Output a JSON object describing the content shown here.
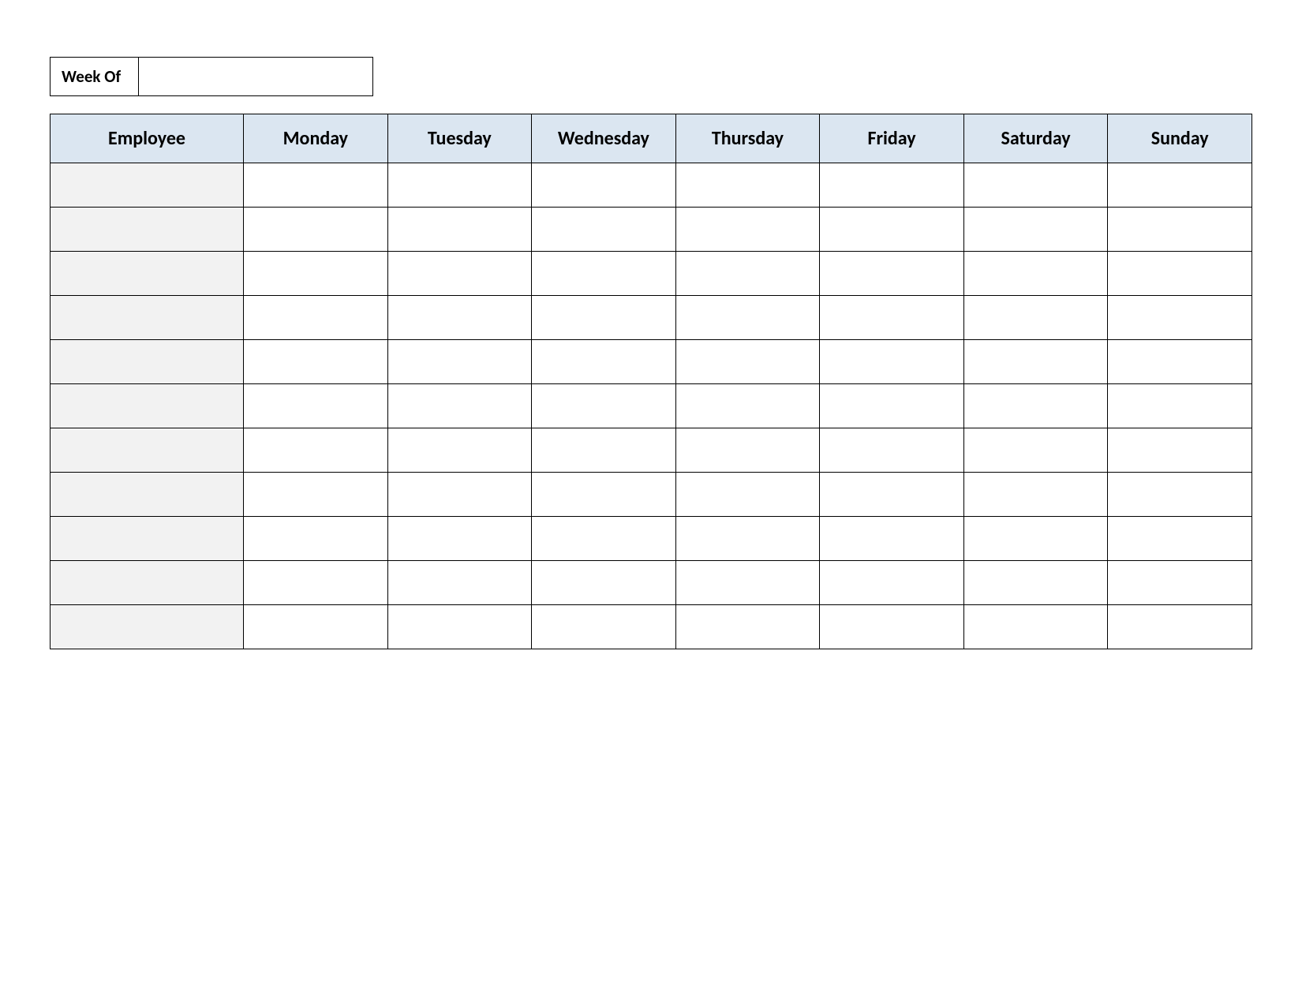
{
  "weekOf": {
    "label": "Week Of",
    "value": ""
  },
  "headers": {
    "employee": "Employee",
    "days": [
      "Monday",
      "Tuesday",
      "Wednesday",
      "Thursday",
      "Friday",
      "Saturday",
      "Sunday"
    ]
  },
  "rows": [
    {
      "employee": "",
      "mon": "",
      "tue": "",
      "wed": "",
      "thu": "",
      "fri": "",
      "sat": "",
      "sun": ""
    },
    {
      "employee": "",
      "mon": "",
      "tue": "",
      "wed": "",
      "thu": "",
      "fri": "",
      "sat": "",
      "sun": ""
    },
    {
      "employee": "",
      "mon": "",
      "tue": "",
      "wed": "",
      "thu": "",
      "fri": "",
      "sat": "",
      "sun": ""
    },
    {
      "employee": "",
      "mon": "",
      "tue": "",
      "wed": "",
      "thu": "",
      "fri": "",
      "sat": "",
      "sun": ""
    },
    {
      "employee": "",
      "mon": "",
      "tue": "",
      "wed": "",
      "thu": "",
      "fri": "",
      "sat": "",
      "sun": ""
    },
    {
      "employee": "",
      "mon": "",
      "tue": "",
      "wed": "",
      "thu": "",
      "fri": "",
      "sat": "",
      "sun": ""
    },
    {
      "employee": "",
      "mon": "",
      "tue": "",
      "wed": "",
      "thu": "",
      "fri": "",
      "sat": "",
      "sun": ""
    },
    {
      "employee": "",
      "mon": "",
      "tue": "",
      "wed": "",
      "thu": "",
      "fri": "",
      "sat": "",
      "sun": ""
    },
    {
      "employee": "",
      "mon": "",
      "tue": "",
      "wed": "",
      "thu": "",
      "fri": "",
      "sat": "",
      "sun": ""
    },
    {
      "employee": "",
      "mon": "",
      "tue": "",
      "wed": "",
      "thu": "",
      "fri": "",
      "sat": "",
      "sun": ""
    },
    {
      "employee": "",
      "mon": "",
      "tue": "",
      "wed": "",
      "thu": "",
      "fri": "",
      "sat": "",
      "sun": ""
    }
  ]
}
